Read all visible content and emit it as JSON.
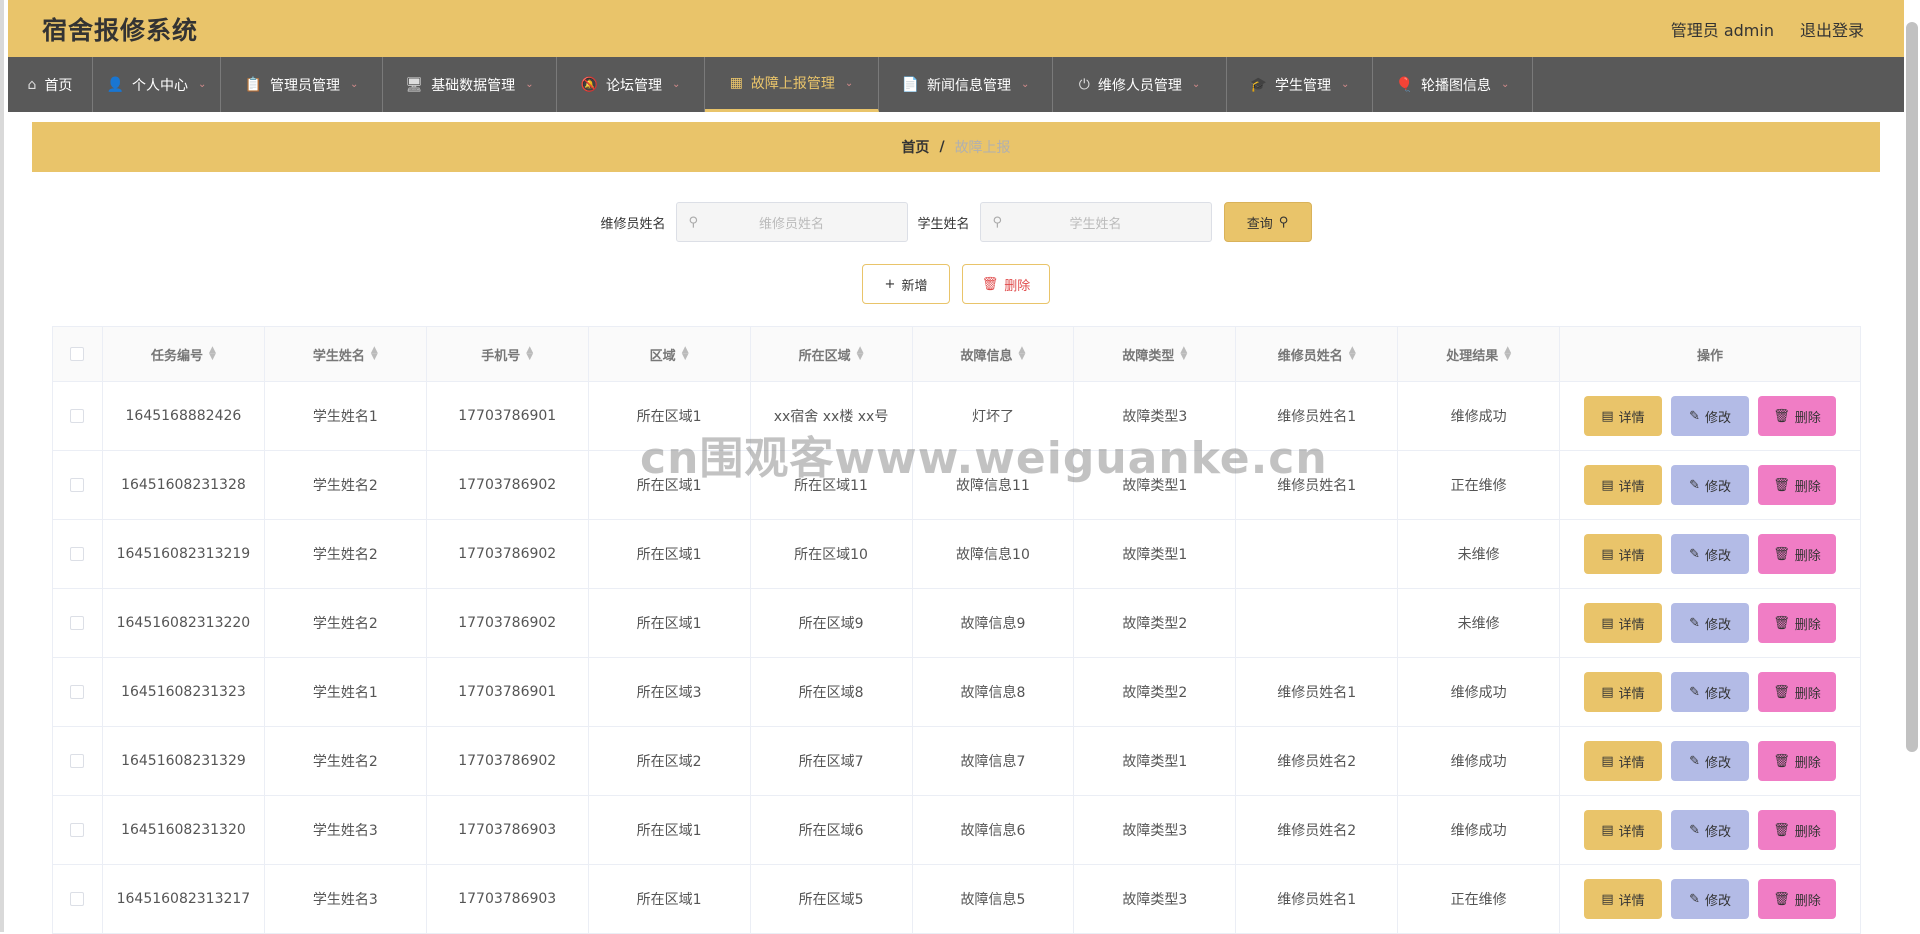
{
  "app": {
    "title": "宿舍报修系统",
    "user_label": "管理员 admin",
    "logout_label": "退出登录"
  },
  "nav": [
    {
      "label": "首页",
      "icon": "home-icon",
      "width": 85,
      "chev": false,
      "active": false
    },
    {
      "label": "个人中心",
      "icon": "person-icon",
      "width": 128,
      "chev": true,
      "active": false
    },
    {
      "label": "管理员管理",
      "icon": "clipboard-icon",
      "width": 162,
      "chev": true,
      "active": false
    },
    {
      "label": "基础数据管理",
      "icon": "monitor-icon",
      "width": 174,
      "chev": true,
      "active": false
    },
    {
      "label": "论坛管理",
      "icon": "bell-off-icon",
      "width": 148,
      "chev": true,
      "active": false
    },
    {
      "label": "故障上报管理",
      "icon": "grid-icon",
      "width": 174,
      "chev": true,
      "active": true
    },
    {
      "label": "新闻信息管理",
      "icon": "document-icon",
      "width": 174,
      "chev": true,
      "active": false
    },
    {
      "label": "维修人员管理",
      "icon": "power-icon",
      "width": 174,
      "chev": true,
      "active": false
    },
    {
      "label": "学生管理",
      "icon": "student-icon",
      "width": 146,
      "chev": true,
      "active": false
    },
    {
      "label": "轮播图信息",
      "icon": "balloon-icon",
      "width": 160,
      "chev": true,
      "active": false
    }
  ],
  "breadcrumb": {
    "home": "首页",
    "separator": "/",
    "current": "故障上报"
  },
  "search": {
    "repairer_label": "维修员姓名",
    "repairer_placeholder": "维修员姓名",
    "student_label": "学生姓名",
    "student_placeholder": "学生姓名",
    "query_label": "查询"
  },
  "actions": {
    "add_label": "新增",
    "delete_label": "删除"
  },
  "table": {
    "headers": [
      "任务编号",
      "学生姓名",
      "手机号",
      "区域",
      "所在区域",
      "故障信息",
      "故障类型",
      "维修员姓名",
      "处理结果"
    ],
    "ops_header": "操作",
    "op_labels": {
      "detail": "详情",
      "edit": "修改",
      "remove": "删除"
    },
    "rows": [
      [
        "1645168882426",
        "学生姓名1",
        "17703786901",
        "所在区域1",
        "xx宿舍 xx楼 xx号",
        "灯坏了",
        "故障类型3",
        "维修员姓名1",
        "维修成功"
      ],
      [
        "16451608231328",
        "学生姓名2",
        "17703786902",
        "所在区域1",
        "所在区域11",
        "故障信息11",
        "故障类型1",
        "维修员姓名1",
        "正在维修"
      ],
      [
        "164516082313219",
        "学生姓名2",
        "17703786902",
        "所在区域1",
        "所在区域10",
        "故障信息10",
        "故障类型1",
        "",
        "未维修"
      ],
      [
        "164516082313220",
        "学生姓名2",
        "17703786902",
        "所在区域1",
        "所在区域9",
        "故障信息9",
        "故障类型2",
        "",
        "未维修"
      ],
      [
        "16451608231323",
        "学生姓名1",
        "17703786901",
        "所在区域3",
        "所在区域8",
        "故障信息8",
        "故障类型2",
        "维修员姓名1",
        "维修成功"
      ],
      [
        "16451608231329",
        "学生姓名2",
        "17703786902",
        "所在区域2",
        "所在区域7",
        "故障信息7",
        "故障类型1",
        "维修员姓名2",
        "维修成功"
      ],
      [
        "16451608231320",
        "学生姓名3",
        "17703786903",
        "所在区域1",
        "所在区域6",
        "故障信息6",
        "故障类型3",
        "维修员姓名2",
        "维修成功"
      ],
      [
        "164516082313217",
        "学生姓名3",
        "17703786903",
        "所在区域1",
        "所在区域5",
        "故障信息5",
        "故障类型3",
        "维修员姓名1",
        "正在维修"
      ]
    ]
  },
  "watermark": "cn围观客www.weiguanke.cn",
  "colors": {
    "accent": "#e9c46a",
    "nav_bg": "#595959",
    "edit": "#b3bbe6",
    "remove": "#f07dc5"
  }
}
